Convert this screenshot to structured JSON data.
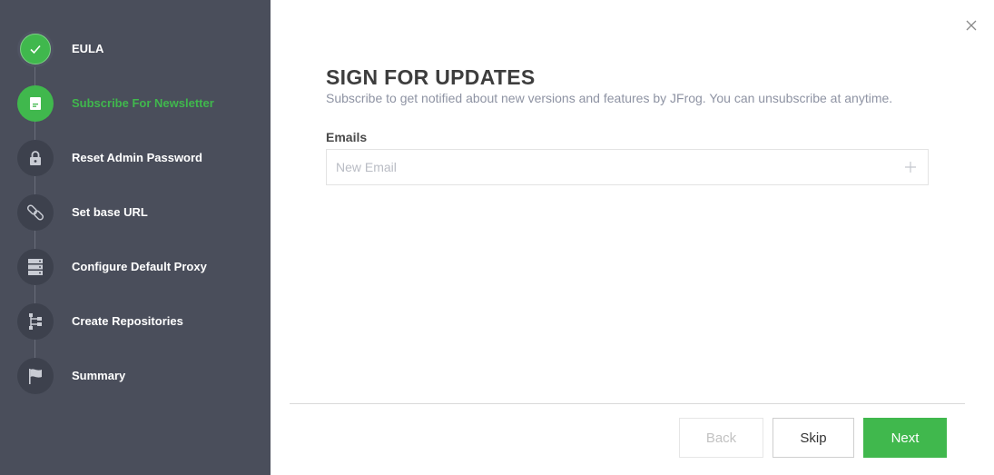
{
  "sidebar": {
    "steps": [
      {
        "label": "EULA",
        "icon": "check-icon",
        "state": "done"
      },
      {
        "label": "Subscribe For Newsletter",
        "icon": "document-icon",
        "state": "active"
      },
      {
        "label": "Reset Admin Password",
        "icon": "lock-icon",
        "state": "pending"
      },
      {
        "label": "Set base URL",
        "icon": "link-icon",
        "state": "pending"
      },
      {
        "label": "Configure Default Proxy",
        "icon": "server-icon",
        "state": "pending"
      },
      {
        "label": "Create Repositories",
        "icon": "repository-tree-icon",
        "state": "pending"
      },
      {
        "label": "Summary",
        "icon": "flag-icon",
        "state": "pending"
      }
    ]
  },
  "main": {
    "title": "SIGN FOR UPDATES",
    "subtitle": "Subscribe to get notified about new versions and features by JFrog. You can unsubscribe at anytime.",
    "emails_label": "Emails",
    "email_placeholder": "New Email",
    "email_value": ""
  },
  "footer": {
    "back_label": "Back",
    "skip_label": "Skip",
    "next_label": "Next"
  },
  "colors": {
    "sidebar_bg": "#4a4e5b",
    "accent_green": "#40b84d",
    "step_circle": "#3d414d"
  }
}
